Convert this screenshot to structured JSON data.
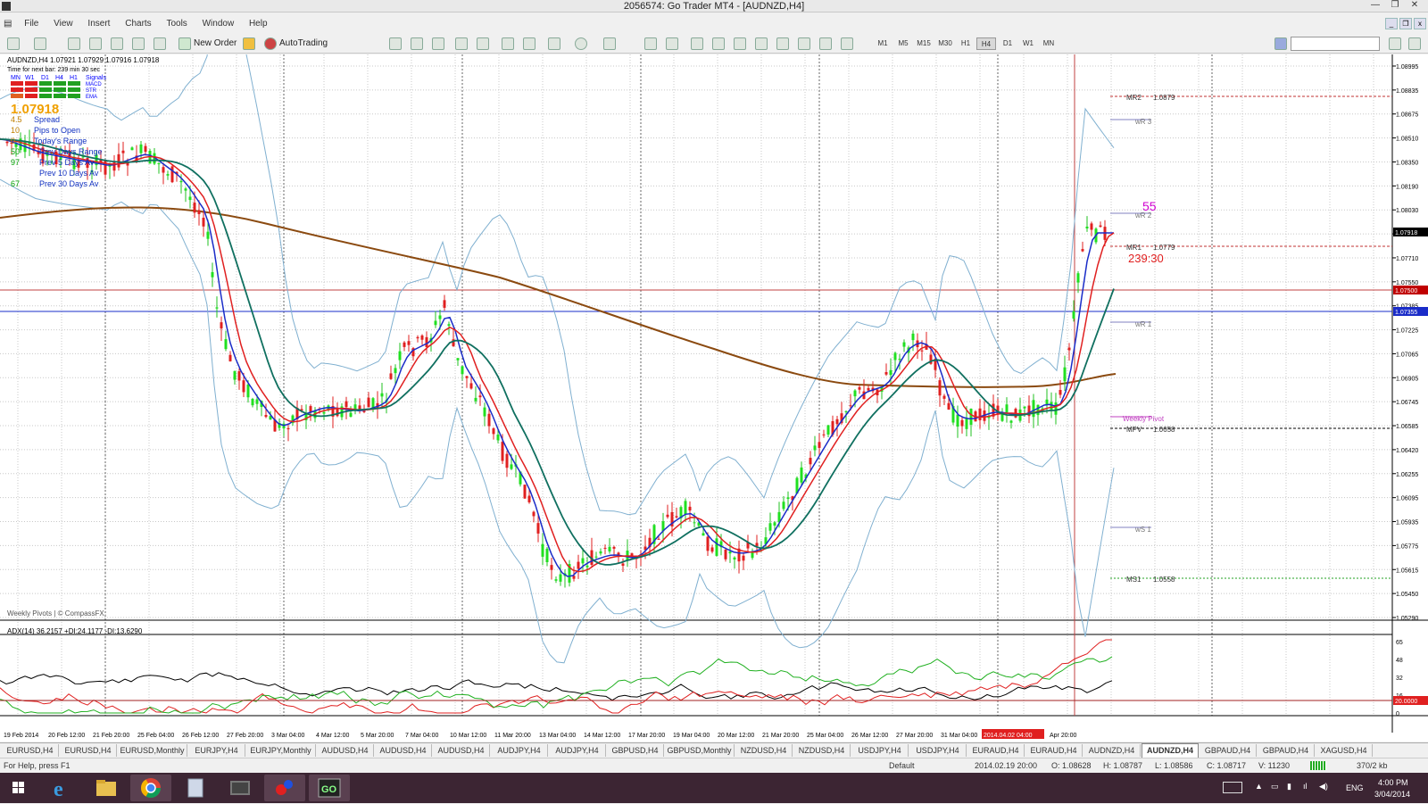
{
  "window": {
    "title": "2056574: Go Trader MT4 - [AUDNZD,H4]",
    "controls": [
      "—",
      "❐",
      "✕"
    ]
  },
  "menu": {
    "items": [
      "File",
      "View",
      "Insert",
      "Charts",
      "Tools",
      "Window",
      "Help"
    ]
  },
  "toolbar": {
    "new_order_label": "New Order",
    "autotrading_label": "AutoTrading",
    "timeframes": [
      "M1",
      "M5",
      "M15",
      "M30",
      "H1",
      "H4",
      "D1",
      "W1",
      "MN"
    ],
    "active_timeframe": "H4"
  },
  "chart": {
    "header": "AUDNZD,H4  1.07921 1.07929 1.07916 1.07918",
    "bar_timer": "Time for next bar: 239 min 30 sec",
    "signal_periods": [
      "MN",
      "W1",
      "D1",
      "H4",
      "H1"
    ],
    "signal_title": "Signals",
    "signal_rows": [
      "MACD",
      "STR",
      "EMA"
    ],
    "big_price": "1.07918",
    "info_values": [
      "4.5",
      "10",
      "0",
      "50",
      "97",
      "67"
    ],
    "info_labels": [
      "Spread",
      "Pips to Open",
      "Today's Range",
      "Prev Days Range",
      "Prev 5 Days Av",
      "Prev 10 Days Av",
      "Prev 30 Days Av"
    ],
    "watermark": "Weekly Pivots | © CompassFX",
    "price_axis": [
      "1.08995",
      "1.08835",
      "1.08675",
      "1.08510",
      "1.08350",
      "1.08190",
      "1.08030",
      "1.07870",
      "1.07710",
      "1.07550",
      "1.07385",
      "1.07225",
      "1.07065",
      "1.06905",
      "1.06745",
      "1.06585",
      "1.06420",
      "1.06255",
      "1.06095",
      "1.05935",
      "1.05775",
      "1.05615",
      "1.05450",
      "1.05290"
    ],
    "price_tags": [
      {
        "text": "1.07918",
        "bg": "#000000"
      },
      {
        "text": "1.07500",
        "bg": "#c00000"
      },
      {
        "text": "1.07355",
        "bg": "#1a2cc8"
      }
    ],
    "pivots": [
      {
        "label": "MR2",
        "value": "1.0879"
      },
      {
        "label": "wR 3",
        "value": ""
      },
      {
        "label": "wR 2",
        "value": ""
      },
      {
        "label": "MR1",
        "value": "1.0779"
      },
      {
        "label": "wR 1",
        "value": ""
      },
      {
        "label": "Weekly Pivot",
        "value": ""
      },
      {
        "label": "MPV",
        "value": "1.0658"
      },
      {
        "label": "wS 1",
        "value": ""
      },
      {
        "label": "MS1",
        "value": "1.0558"
      }
    ],
    "big_number": "55",
    "countdown": "239:30",
    "adx_header": "ADX(14) 36.2157 +DI:24.1177 -DI:13.6290",
    "adx_axis": [
      "65",
      "48",
      "32",
      "16",
      "0"
    ],
    "adx_level_tag": "20.0000",
    "time_axis": [
      "19 Feb 2014",
      "20 Feb 12:00",
      "21 Feb 20:00",
      "25 Feb 04:00",
      "26 Feb 12:00",
      "27 Feb 20:00",
      "3 Mar 04:00",
      "4 Mar 12:00",
      "5 Mar 20:00",
      "7 Mar 04:00",
      "10 Mar 12:00",
      "11 Mar 20:00",
      "13 Mar 04:00",
      "14 Mar 12:00",
      "17 Mar 20:00",
      "19 Mar 04:00",
      "20 Mar 12:00",
      "21 Mar 20:00",
      "25 Mar 04:00",
      "26 Mar 12:00",
      "27 Mar 20:00",
      "31 Mar 04:00",
      "2014.04.02 04:00",
      "Apr 20:00"
    ]
  },
  "tabs": [
    "EURUSD,H4",
    "EURUSD,H4",
    "EURUSD,Monthly",
    "EURJPY,H4",
    "EURJPY,Monthly",
    "AUDUSD,H4",
    "AUDUSD,H4",
    "AUDUSD,H4",
    "AUDJPY,H4",
    "AUDJPY,H4",
    "GBPUSD,H4",
    "GBPUSD,Monthly",
    "NZDUSD,H4",
    "NZDUSD,H4",
    "USDJPY,H4",
    "USDJPY,H4",
    "EURAUD,H4",
    "EURAUD,H4",
    "AUDNZD,H4",
    "AUDNZD,H4",
    "GBPAUD,H4",
    "GBPAUD,H4",
    "XAGUSD,H4"
  ],
  "active_tab_index": 19,
  "status": {
    "help": "For Help, press F1",
    "profile": "Default",
    "datetime": "2014.02.19 20:00",
    "open": "O: 1.08628",
    "high": "H: 1.08787",
    "low": "L: 1.08586",
    "close": "C: 1.08717",
    "volume": "V: 11230",
    "traffic": "370/2 kb"
  },
  "taskbar": {
    "lang": "ENG",
    "time": "4:00 PM",
    "date": "3/04/2014"
  }
}
